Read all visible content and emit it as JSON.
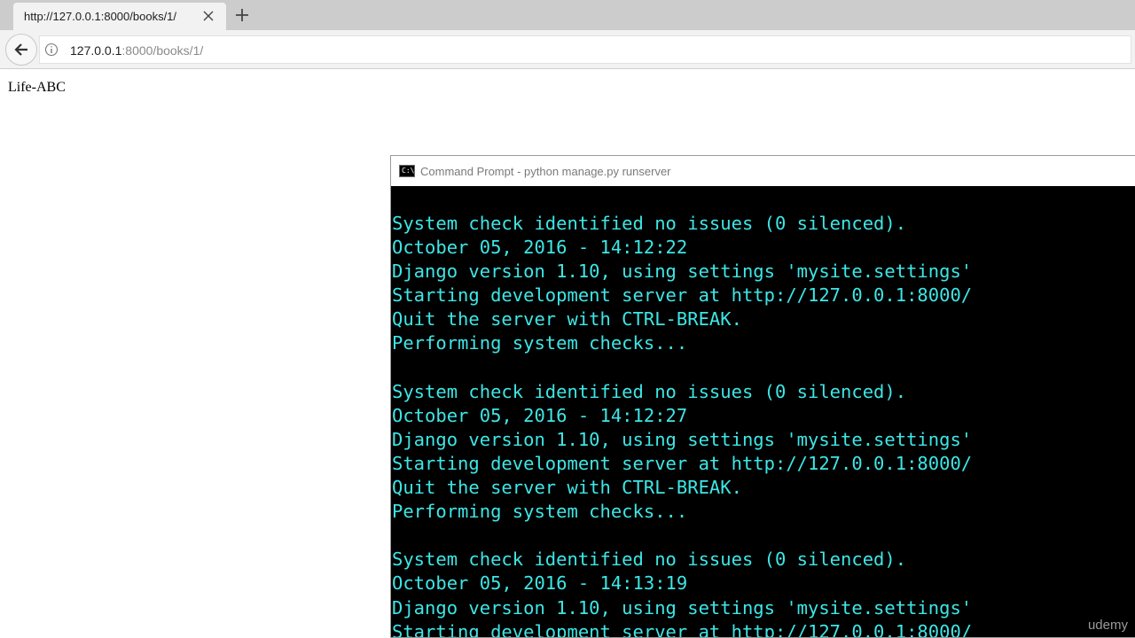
{
  "browser": {
    "tab_title": "http://127.0.0.1:8000/books/1/",
    "url_host": "127.0.0.1",
    "url_rest": ":8000/books/1/"
  },
  "page": {
    "text": "Life-ABC"
  },
  "console": {
    "title": "Command Prompt - python  manage.py runserver",
    "icon_label": "C:\\",
    "lines": [
      "System check identified no issues (0 silenced).",
      "October 05, 2016 - 14:12:22",
      "Django version 1.10, using settings 'mysite.settings'",
      "Starting development server at http://127.0.0.1:8000/",
      "Quit the server with CTRL-BREAK.",
      "Performing system checks...",
      "",
      "System check identified no issues (0 silenced).",
      "October 05, 2016 - 14:12:27",
      "Django version 1.10, using settings 'mysite.settings'",
      "Starting development server at http://127.0.0.1:8000/",
      "Quit the server with CTRL-BREAK.",
      "Performing system checks...",
      "",
      "System check identified no issues (0 silenced).",
      "October 05, 2016 - 14:13:19",
      "Django version 1.10, using settings 'mysite.settings'",
      "Starting development server at http://127.0.0.1:8000/"
    ]
  },
  "watermark": "udemy",
  "colors": {
    "console_text": "#3ee6e6",
    "console_bg": "#000000"
  },
  "icons": [
    "close-icon",
    "plus-icon",
    "back-arrow-icon",
    "info-icon",
    "cmd-icon"
  ]
}
